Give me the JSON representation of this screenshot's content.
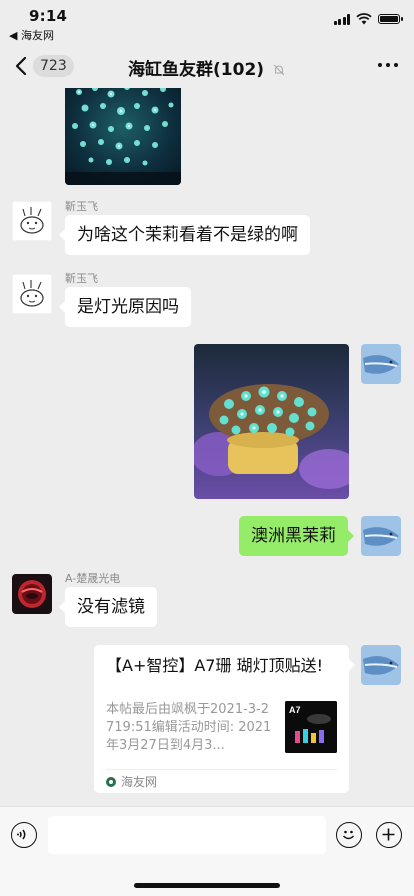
{
  "status": {
    "time": "9:14",
    "back_app": "◀ 海友网"
  },
  "nav": {
    "count": "723",
    "title": "海缸鱼友群(102)"
  },
  "messages": {
    "m1": {
      "sender": "靳玉飞",
      "text": "为啥这个茉莉看着不是绿的啊"
    },
    "m2": {
      "sender": "靳玉飞",
      "text": "是灯光原因吗"
    },
    "m3": {
      "text": "澳洲黑茉莉"
    },
    "m4": {
      "sender": "A-楚晟光电",
      "text": "没有滤镜"
    }
  },
  "card": {
    "title": "【A+智控】A7珊 瑚灯顶贴送!",
    "desc": "本帖最后由飒枫于2021-3-2719:51编辑活动时间: 2021年3月27日到4月3...",
    "thumb_label": "A7",
    "source": "海友网"
  },
  "input": {
    "placeholder": ""
  },
  "colors": {
    "bubble_self": "#95ec69",
    "bubble_other": "#ffffff",
    "background": "#ededed"
  },
  "icons": [
    "back-chevron-icon",
    "mute-bell-icon",
    "more-dots-icon",
    "voice-icon",
    "emoji-icon",
    "plus-icon"
  ]
}
